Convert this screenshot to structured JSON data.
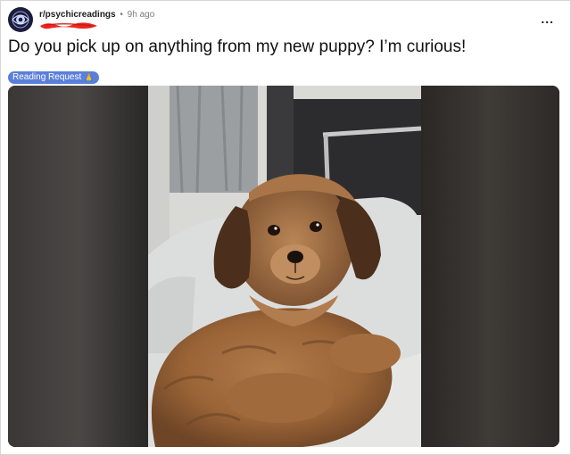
{
  "post": {
    "subreddit": "r/psychicreadings",
    "separator": "•",
    "time_ago": "9h ago",
    "more_label": "...",
    "title": "Do you pick up on anything from my new puppy? I’m curious!",
    "flair": {
      "text": "Reading Request",
      "emoji": "🙏",
      "color": "#5b7fd9"
    }
  },
  "icons": {
    "avatar": "subreddit-avatar-icon",
    "more": "more-options-icon",
    "redaction": "redaction-scribble"
  },
  "colors": {
    "flair_bg": "#5b7fd9",
    "redaction": "#e8261f",
    "media_bg": "#2b2a28"
  }
}
